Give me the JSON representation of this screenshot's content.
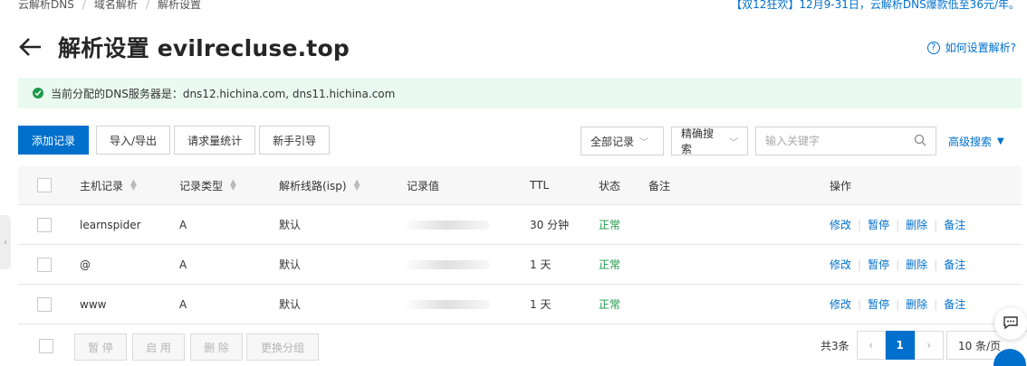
{
  "breadcrumb": [
    "云解析DNS",
    "域名解析",
    "解析设置"
  ],
  "promo": "【双12狂欢】12月9-31日，云解析DNS爆款低至36元/年。",
  "title": "解析设置 evilrecluse.top",
  "help": "如何设置解析?",
  "dns_notice": "当前分配的DNS服务器是：dns12.hichina.com, dns11.hichina.com",
  "toolbar": {
    "add": "添加记录",
    "import_export": "导入/导出",
    "request_stats": "请求量统计",
    "guide": "新手引导"
  },
  "filters": {
    "record_filter": "全部记录",
    "search_mode": "精确搜索",
    "keyword_placeholder": "输入关键字",
    "advanced": "高级搜索"
  },
  "columns": {
    "host": "主机记录",
    "type": "记录类型",
    "line": "解析线路(isp)",
    "value": "记录值",
    "ttl": "TTL",
    "status": "状态",
    "remark": "备注",
    "actions": "操作"
  },
  "rows": [
    {
      "host": "learnspider",
      "type": "A",
      "line": "默认",
      "ttl": "30 分钟",
      "status": "正常"
    },
    {
      "host": "@",
      "type": "A",
      "line": "默认",
      "ttl": "1 天",
      "status": "正常"
    },
    {
      "host": "www",
      "type": "A",
      "line": "默认",
      "ttl": "1 天",
      "status": "正常"
    }
  ],
  "row_actions": {
    "edit": "修改",
    "pause": "暂停",
    "delete": "删除",
    "remark": "备注"
  },
  "bulk": {
    "pause": "暂 停",
    "enable": "启 用",
    "delete": "删 除",
    "group": "更换分组"
  },
  "pagination": {
    "total": "共3条",
    "current": "1",
    "page_size": "10 条/页"
  },
  "colors": {
    "primary": "#0070cc",
    "success": "#1b9a48",
    "notice_bg": "#eafaf1"
  }
}
